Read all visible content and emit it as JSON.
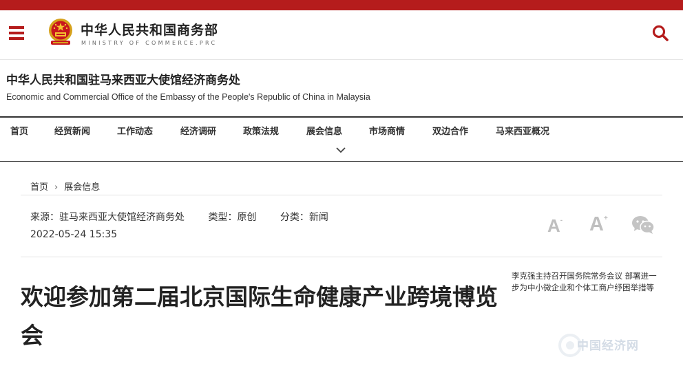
{
  "site": {
    "name_cn": "中华人民共和国商务部",
    "name_en": "MINISTRY OF COMMERCE.PRC",
    "accent": "#b51c1c"
  },
  "office": {
    "name_cn": "中华人民共和国驻马来西亚大使馆经济商务处",
    "name_en": "Economic and Commercial Office of the Embassy of the People's Republic of China in Malaysia"
  },
  "nav": {
    "items": [
      {
        "label": "首页"
      },
      {
        "label": "经贸新闻"
      },
      {
        "label": "工作动态"
      },
      {
        "label": "经济调研"
      },
      {
        "label": "政策法规"
      },
      {
        "label": "展会信息"
      },
      {
        "label": "市场商情"
      },
      {
        "label": "双边合作"
      },
      {
        "label": "马来西亚概况"
      }
    ]
  },
  "breadcrumb": {
    "home": "首页",
    "current": "展会信息"
  },
  "meta": {
    "source": "来源：驻马来西亚大使馆经济商务处",
    "type": "类型：原创",
    "category": "分类：新闻",
    "date": "2022-05-24 15:35"
  },
  "tools": {
    "font_small": "A",
    "font_small_sup": "-",
    "font_large": "A",
    "font_large_sup": "+"
  },
  "article": {
    "title": "欢迎参加第二届北京国际生命健康产业跨境博览会"
  },
  "related": {
    "text": "李克强主持召开国务院常务会议 部署进一步为中小微企业和个体工商户纾困举措等"
  },
  "watermark": {
    "text": "中国经济网"
  }
}
